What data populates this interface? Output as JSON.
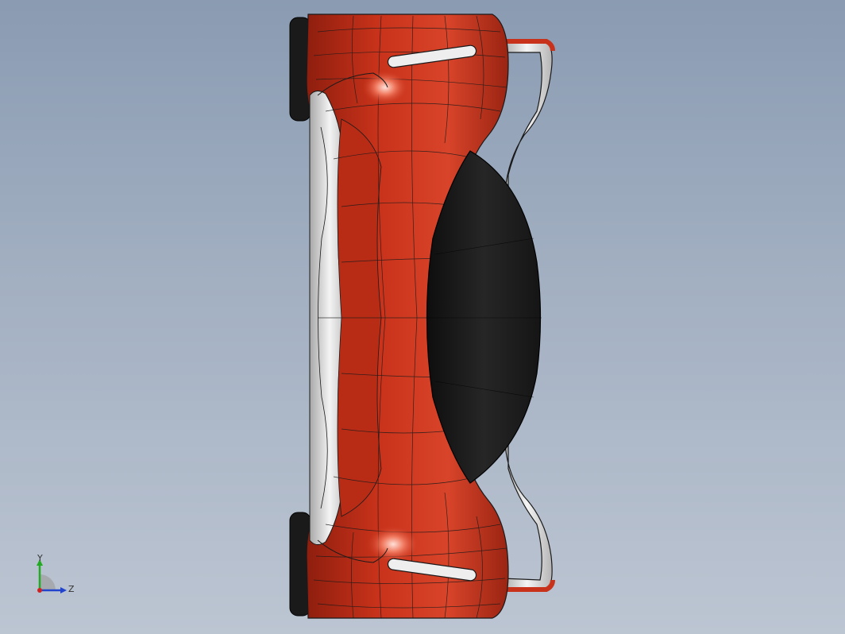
{
  "viewport": {
    "background_top": "#8a9bb2",
    "background_bottom": "#bcc5d2"
  },
  "model": {
    "body_color": "#c8321a",
    "body_highlight": "#f0705a",
    "body_shadow": "#7a1a0c",
    "canopy_color": "#1c1c1c",
    "frame_color": "#e6e6e6",
    "tire_color": "#1a1a1a",
    "edge_color": "#1a1a1a"
  },
  "triad": {
    "y_label": "Y",
    "z_label": "Z",
    "y_color": "#22aa22",
    "z_color": "#2244cc",
    "origin_color": "#cc2222"
  }
}
